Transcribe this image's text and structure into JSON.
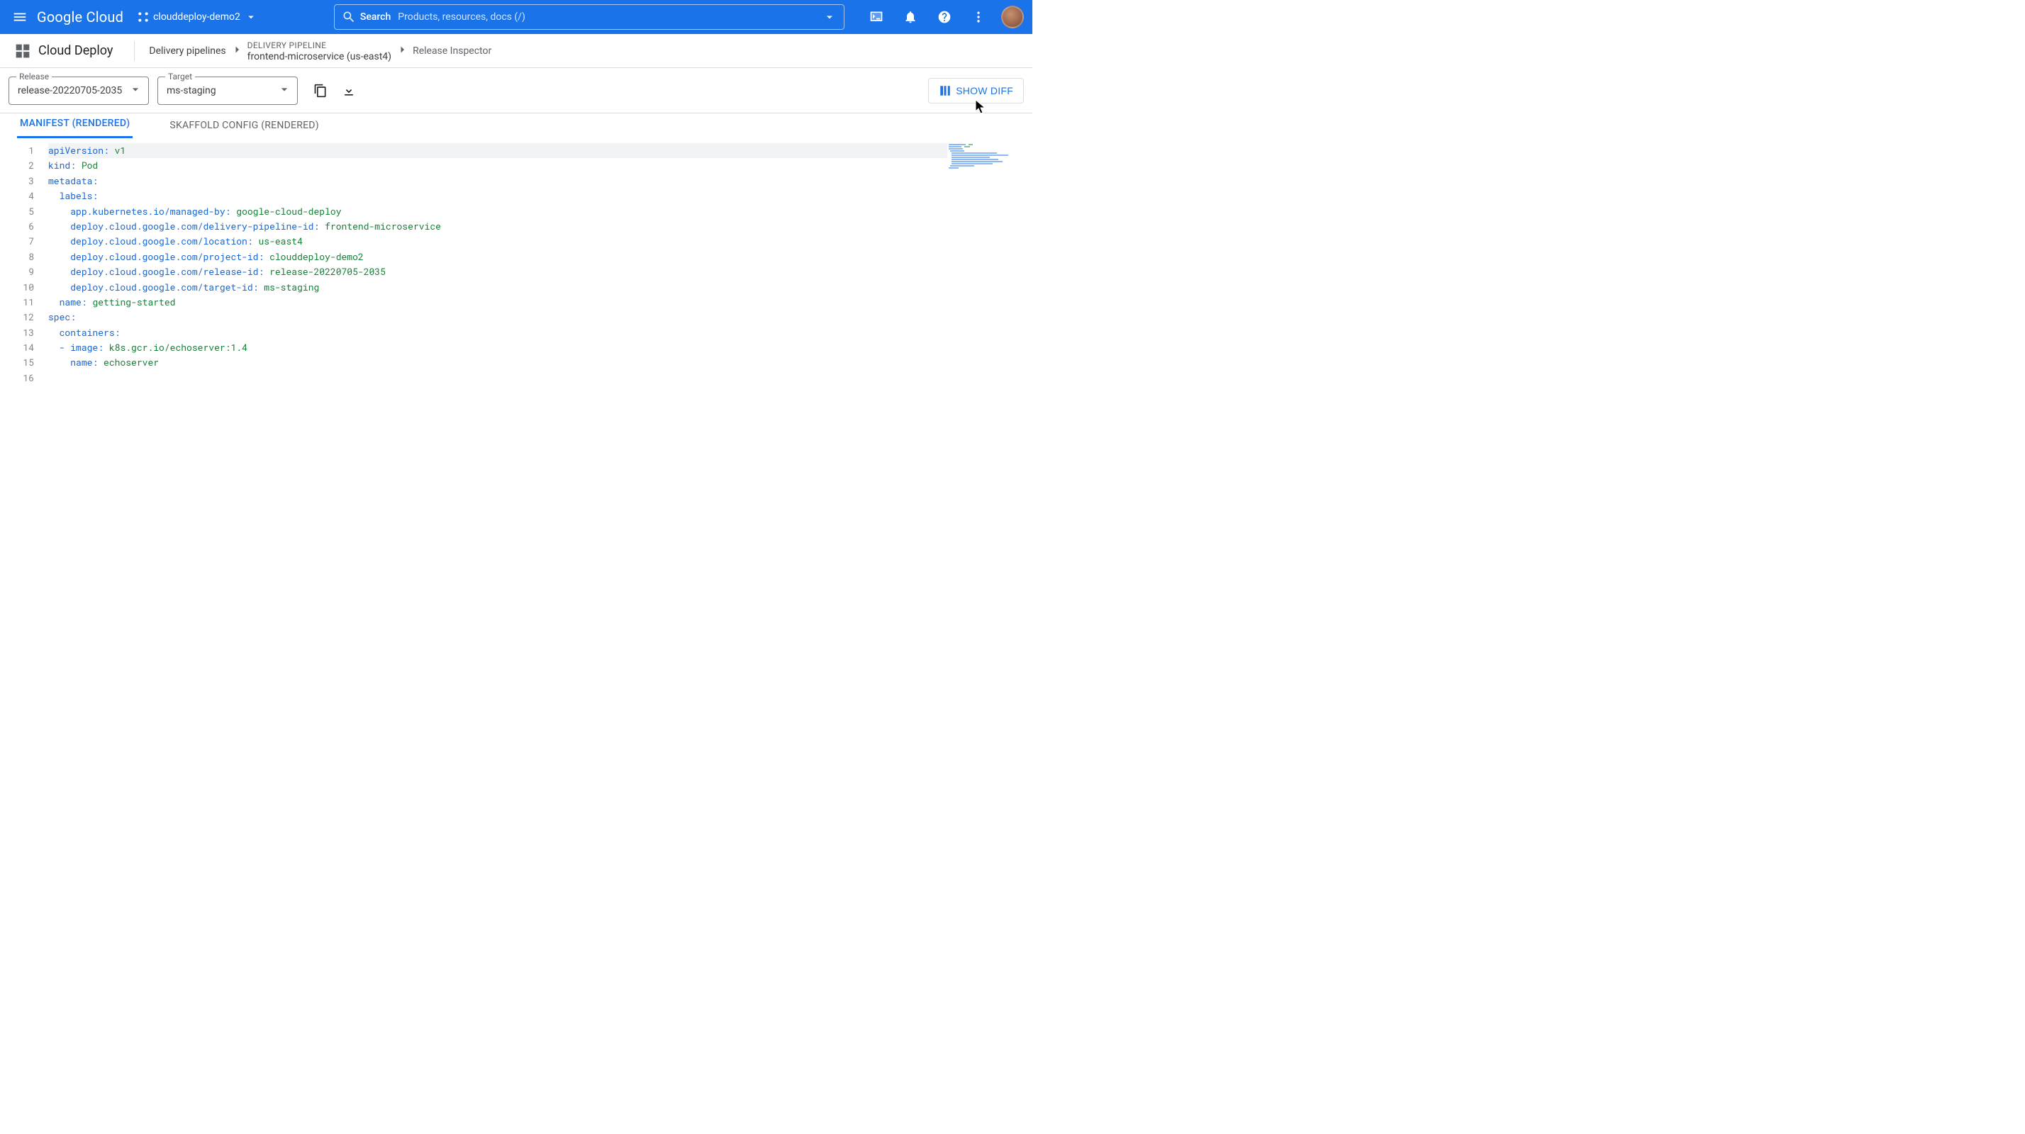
{
  "appbar": {
    "logo": "Google Cloud",
    "project": "clouddeploy-demo2",
    "search_label": "Search",
    "search_placeholder": "Products, resources, docs (/)"
  },
  "secondary": {
    "product": "Cloud Deploy",
    "crumb1": "Delivery pipelines",
    "crumb2_over": "DELIVERY PIPELINE",
    "crumb2_under": "frontend-microservice (us-east4)",
    "crumb3": "Release Inspector"
  },
  "actions": {
    "release_label": "Release",
    "release_value": "release-20220705-2035",
    "target_label": "Target",
    "target_value": "ms-staging",
    "diff_label": "SHOW DIFF"
  },
  "tabs": {
    "t0": "MANIFEST (RENDERED)",
    "t1": "SKAFFOLD CONFIG (RENDERED)"
  },
  "code": {
    "lines": [
      {
        "n": "1",
        "segs": [
          [
            "key",
            "apiVersion"
          ],
          [
            "col",
            ": "
          ],
          [
            "val",
            "v1"
          ]
        ]
      },
      {
        "n": "2",
        "segs": [
          [
            "key",
            "kind"
          ],
          [
            "col",
            ": "
          ],
          [
            "val",
            "Pod"
          ]
        ]
      },
      {
        "n": "3",
        "segs": [
          [
            "key",
            "metadata"
          ],
          [
            "col",
            ":"
          ]
        ]
      },
      {
        "n": "4",
        "segs": [
          [
            "plain",
            "  "
          ],
          [
            "key",
            "labels"
          ],
          [
            "col",
            ":"
          ]
        ]
      },
      {
        "n": "5",
        "segs": [
          [
            "plain",
            "    "
          ],
          [
            "key",
            "app.kubernetes.io/managed-by"
          ],
          [
            "col",
            ": "
          ],
          [
            "val",
            "google-cloud-deploy"
          ]
        ]
      },
      {
        "n": "6",
        "segs": [
          [
            "plain",
            "    "
          ],
          [
            "key",
            "deploy.cloud.google.com/delivery-pipeline-id"
          ],
          [
            "col",
            ": "
          ],
          [
            "val",
            "frontend-microservice"
          ]
        ]
      },
      {
        "n": "7",
        "segs": [
          [
            "plain",
            "    "
          ],
          [
            "key",
            "deploy.cloud.google.com/location"
          ],
          [
            "col",
            ": "
          ],
          [
            "val",
            "us-east4"
          ]
        ]
      },
      {
        "n": "8",
        "segs": [
          [
            "plain",
            "    "
          ],
          [
            "key",
            "deploy.cloud.google.com/project-id"
          ],
          [
            "col",
            ": "
          ],
          [
            "val",
            "clouddeploy-demo2"
          ]
        ]
      },
      {
        "n": "9",
        "segs": [
          [
            "plain",
            "    "
          ],
          [
            "key",
            "deploy.cloud.google.com/release-id"
          ],
          [
            "col",
            ": "
          ],
          [
            "val",
            "release-20220705-2035"
          ]
        ]
      },
      {
        "n": "10",
        "segs": [
          [
            "plain",
            "    "
          ],
          [
            "key",
            "deploy.cloud.google.com/target-id"
          ],
          [
            "col",
            ": "
          ],
          [
            "val",
            "ms-staging"
          ]
        ]
      },
      {
        "n": "11",
        "segs": [
          [
            "plain",
            "  "
          ],
          [
            "key",
            "name"
          ],
          [
            "col",
            ": "
          ],
          [
            "val",
            "getting-started"
          ]
        ]
      },
      {
        "n": "12",
        "segs": [
          [
            "key",
            "spec"
          ],
          [
            "col",
            ":"
          ]
        ]
      },
      {
        "n": "13",
        "segs": [
          [
            "plain",
            "  "
          ],
          [
            "key",
            "containers"
          ],
          [
            "col",
            ":"
          ]
        ]
      },
      {
        "n": "14",
        "segs": [
          [
            "plain",
            "  - "
          ],
          [
            "key",
            "image"
          ],
          [
            "col",
            ": "
          ],
          [
            "val",
            "k8s.gcr.io/echoserver:1.4"
          ]
        ]
      },
      {
        "n": "15",
        "segs": [
          [
            "plain",
            "    "
          ],
          [
            "key",
            "name"
          ],
          [
            "col",
            ": "
          ],
          [
            "val",
            "echoserver"
          ]
        ]
      },
      {
        "n": "16",
        "segs": []
      }
    ]
  }
}
